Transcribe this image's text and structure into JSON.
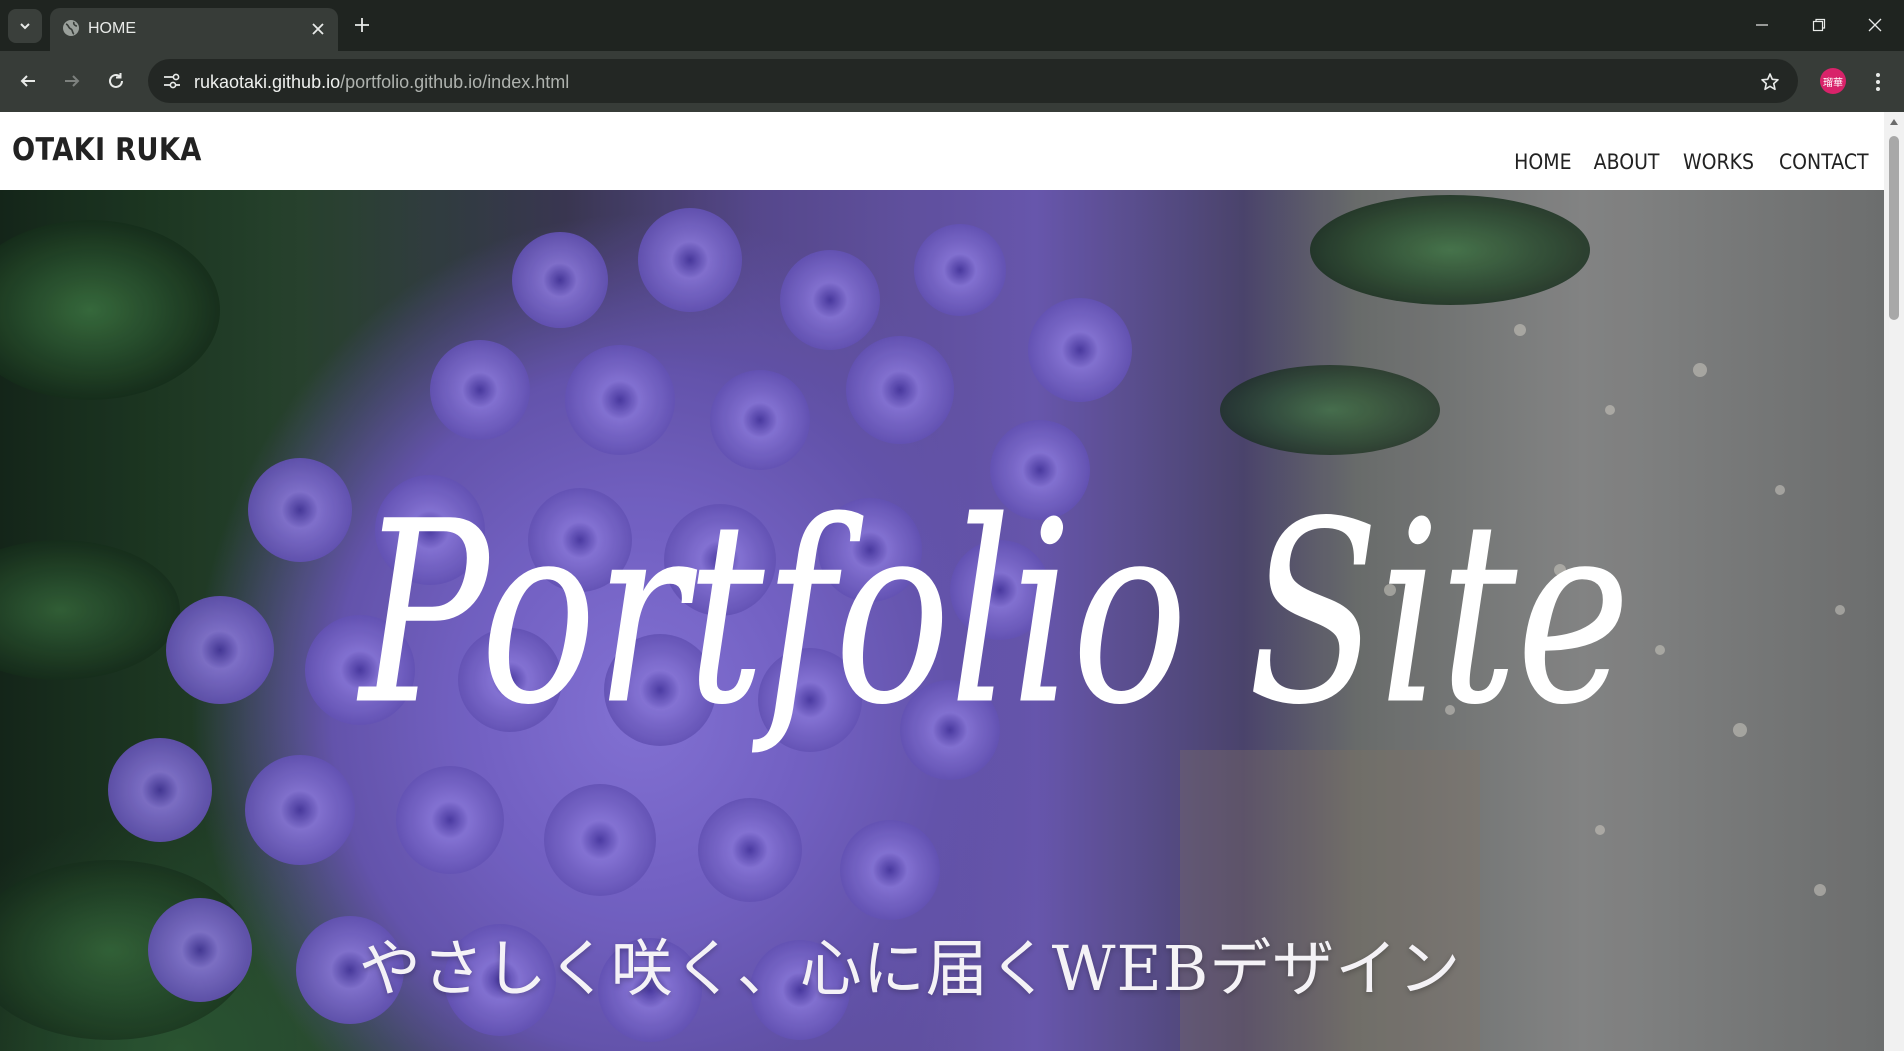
{
  "browser": {
    "tab": {
      "title": "HOME",
      "favicon": "globe-icon"
    },
    "url": {
      "host": "rukaotaki.github.io",
      "path": "/portfolio.github.io/index.html"
    },
    "profile_initials": "瑠華",
    "accent": "#d8236a"
  },
  "site": {
    "logo": "OTAKI RUKA",
    "nav": [
      {
        "label": "HOME"
      },
      {
        "label": "ABOUT"
      },
      {
        "label": "WORKS"
      },
      {
        "label": "CONTACT"
      }
    ]
  },
  "hero": {
    "title": "Portfolio Site",
    "subtitle": "やさしく咲く、心に届くWEBデザイン",
    "background_colors": {
      "flowers": "#7a67cf",
      "leaves": "#1e3a24",
      "path": "#8b8c8c"
    }
  }
}
